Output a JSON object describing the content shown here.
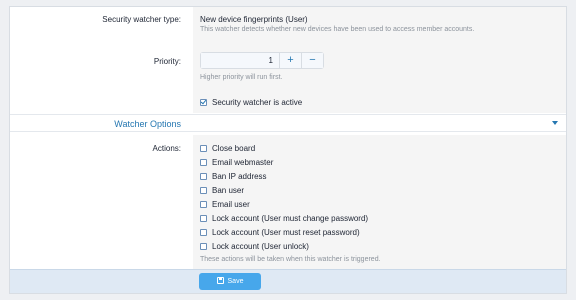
{
  "form": {
    "type_label": "Security watcher type:",
    "type_value": "New device fingerprints (User)",
    "type_description": "This watcher detects whether new devices have been used to access member accounts.",
    "priority_label": "Priority:",
    "priority_value": "1",
    "priority_increment": "+",
    "priority_decrement": "−",
    "priority_hint": "Higher priority will run first.",
    "active_label": "Security watcher is active",
    "active_checked": true
  },
  "options_section": {
    "title": "Watcher Options",
    "caret_icon": "chevron-down-icon"
  },
  "actions": {
    "label": "Actions:",
    "items": [
      {
        "label": "Close board",
        "checked": false
      },
      {
        "label": "Email webmaster",
        "checked": false
      },
      {
        "label": "Ban IP address",
        "checked": false
      },
      {
        "label": "Ban user",
        "checked": false
      },
      {
        "label": "Email user",
        "checked": false
      },
      {
        "label": "Lock account (User must change password)",
        "checked": false
      },
      {
        "label": "Lock account (User must reset password)",
        "checked": false
      },
      {
        "label": "Lock account (User unlock)",
        "checked": false
      }
    ],
    "hint": "These actions will be taken when this watcher is triggered."
  },
  "footer": {
    "save_label": "Save",
    "save_icon": "save-icon"
  },
  "colors": {
    "accent": "#2577b1",
    "button": "#47a7eb",
    "footer_bg": "#dfe9f4"
  }
}
